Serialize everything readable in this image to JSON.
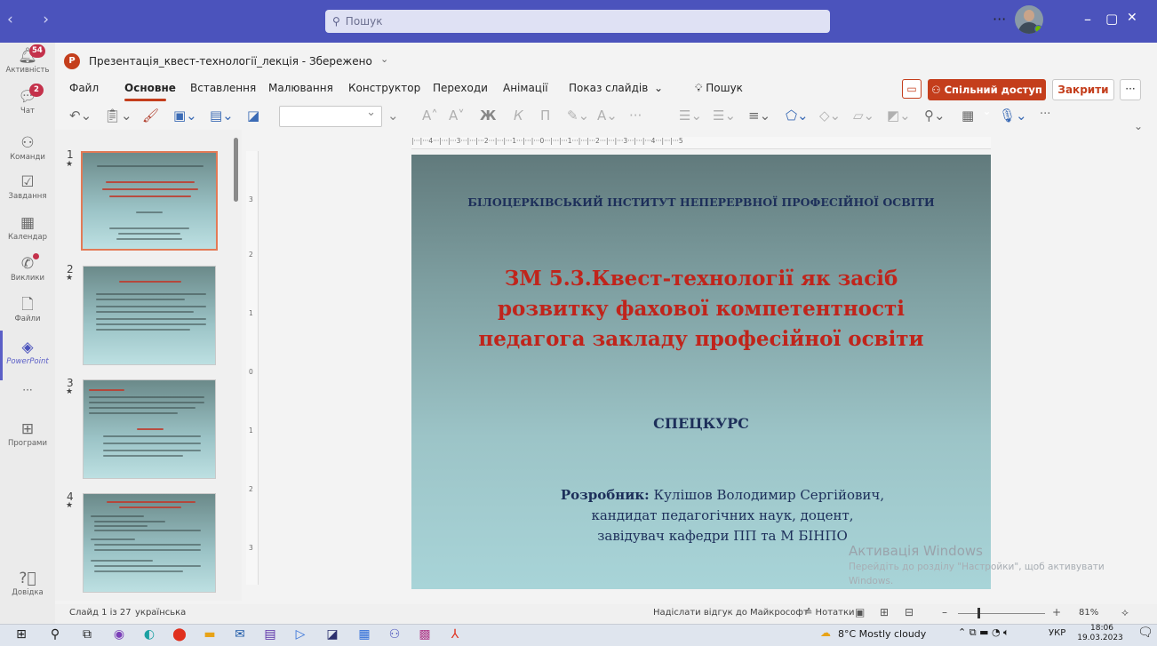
{
  "teams": {
    "nav": "‹ ›",
    "search_placeholder": "Пошук",
    "more": "···",
    "minimize": "–",
    "maximize": "▢",
    "close": "✕"
  },
  "rail": {
    "items": [
      {
        "label": "Активність",
        "icon": "bell-icon",
        "badge": "54"
      },
      {
        "label": "Чат",
        "icon": "chat-icon",
        "badge": "2"
      },
      {
        "label": "Команди",
        "icon": "teams-icon"
      },
      {
        "label": "Завдання",
        "icon": "tasks-icon"
      },
      {
        "label": "Календар",
        "icon": "calendar-icon"
      },
      {
        "label": "Виклики",
        "icon": "phone-icon"
      },
      {
        "label": "Файли",
        "icon": "file-icon"
      },
      {
        "label": "PowerPoint",
        "icon": "powerpoint-icon"
      },
      {
        "label": "···",
        "icon": "more-icon"
      },
      {
        "label": "Програми",
        "icon": "apps-icon"
      },
      {
        "label": "Довідка",
        "icon": "help-icon"
      }
    ]
  },
  "app": {
    "logo": "P",
    "doc_title": "Презентація_квест-технології_лекція - Збережено",
    "tabs": [
      "Файл",
      "Основне",
      "Вставлення",
      "Малювання",
      "Конструктор",
      "Переходи",
      "Анімації",
      "Показ слайдів",
      "⌄",
      "Пошук"
    ],
    "share": "Спільний доступ ⌄",
    "close": "Закрити",
    "more": "···"
  },
  "thumbs": [
    {
      "num": "1"
    },
    {
      "num": "2"
    },
    {
      "num": "3"
    },
    {
      "num": "4"
    }
  ],
  "ruler": {
    "h": "|···|···4···|···|···3···|···|···2···|···|···1···|···|···0···|···|···1···|···|···2···|···|···3···|···|···4···|···|···5",
    "v": [
      "3",
      "2",
      "1",
      "0",
      "1",
      "2",
      "3"
    ]
  },
  "slide": {
    "institute": "БІЛОЦЕРКІВСЬКИЙ ІНСТИТУТ НЕПЕРЕРВНОЇ ПРОФЕСІЙНОЇ ОСВІТИ",
    "title_l1": "ЗМ 5.3.Квест-технології як засіб",
    "title_l2": "розвитку фахової компетентності",
    "title_l3": "педагога закладу професійної освіти",
    "course": "СПЕЦКУРС",
    "author_label": "Розробник:",
    "author_name": " Кулішов Володимир Сергійович,",
    "author_l2": "кандидат педагогічних наук, доцент,",
    "author_l3": "завідувач кафедри ПП та М БІНПО"
  },
  "watermark": {
    "l1": "Активація Windows",
    "l2": "Перейдіть до розділу \"Настройки\", щоб активувати",
    "l3": "Windows."
  },
  "status": {
    "slide": "Слайд 1 із 27",
    "lang": "українська",
    "feedback": "Надіслати відгук до Майкрософт",
    "notes": "≙ Нотатки",
    "zoom": "81%"
  },
  "taskbar": {
    "weather": "8°C  Mostly cloudy",
    "lang": "УКР",
    "time": "18:06",
    "date": "19.03.2023"
  }
}
